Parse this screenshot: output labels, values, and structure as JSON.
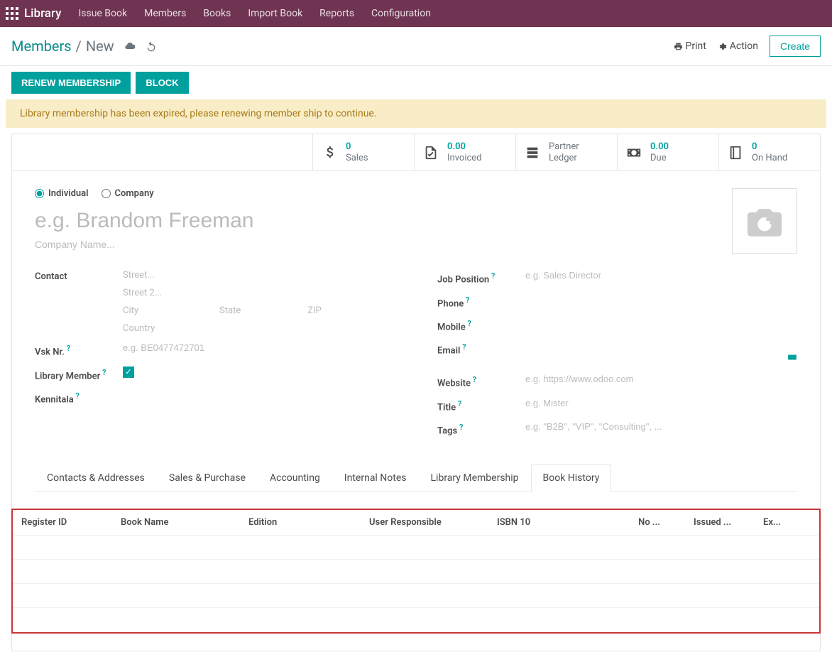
{
  "topnav": {
    "brand": "Library",
    "items": [
      "Issue Book",
      "Members",
      "Books",
      "Import Book",
      "Reports",
      "Configuration"
    ]
  },
  "breadcrumb": {
    "parent": "Members",
    "current": "New"
  },
  "actions": {
    "print": "Print",
    "action": "Action",
    "create": "Create"
  },
  "buttons": {
    "renew": "Renew Membership",
    "block": "Block"
  },
  "alert": "Library membership has been expired, please renewing member ship to continue.",
  "stats": {
    "sales_val": "0",
    "sales_lbl": "Sales",
    "invoiced_val": "0.00",
    "invoiced_lbl": "Invoiced",
    "ledger_l1": "Partner",
    "ledger_l2": "Ledger",
    "due_val": "0.00",
    "due_lbl": "Due",
    "onhand_val": "0",
    "onhand_lbl": "On Hand"
  },
  "radios": {
    "individual": "Individual",
    "company": "Company"
  },
  "placeholders": {
    "name": "e.g. Brandom Freeman",
    "company": "Company Name...",
    "street": "Street...",
    "street2": "Street 2...",
    "city": "City",
    "state": "State",
    "zip": "ZIP",
    "country": "Country",
    "vat": "e.g. BE0477472701",
    "job": "e.g. Sales Director",
    "website": "e.g. https://www.odoo.com",
    "title": "e.g. Mister",
    "tags": "e.g. \"B2B\", \"VIP\", \"Consulting\", ..."
  },
  "labels": {
    "contact": "Contact",
    "vat": "Vsk Nr.",
    "member": "Library Member",
    "kennitala": "Kennitala",
    "job": "Job Position",
    "phone": "Phone",
    "mobile": "Mobile",
    "email": "Email",
    "website": "Website",
    "title": "Title",
    "tags": "Tags"
  },
  "tabs": [
    "Contacts & Addresses",
    "Sales & Purchase",
    "Accounting",
    "Internal Notes",
    "Library Membership",
    "Book History"
  ],
  "columns": {
    "reg": "Register ID",
    "book": "Book Name",
    "ed": "Edition",
    "user": "User Responsible",
    "isbn": "ISBN 10",
    "no": "No ...",
    "iss": "Issued ...",
    "ex": "Ex..."
  }
}
